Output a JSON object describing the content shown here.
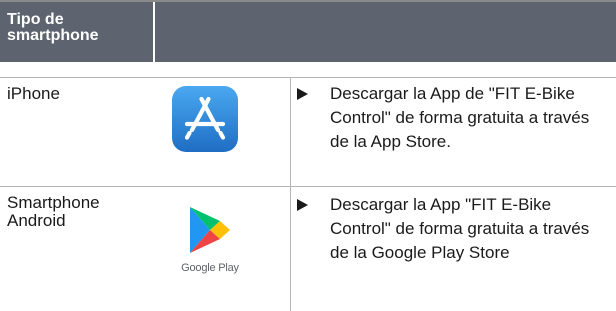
{
  "table": {
    "header": {
      "col1": "Tipo de\nsmartphone",
      "col2": ""
    },
    "rows": [
      {
        "device": "iPhone",
        "store_icon": "app-store-icon",
        "instruction": "Descargar la App de \"FIT E-Bike Control\" de forma gratuita a través de la App Store."
      },
      {
        "device": "Smartphone Android",
        "store_icon": "google-play-icon",
        "store_label": "Google Play",
        "instruction": "Descargar la App \"FIT E-Bike Control\" de forma gratuita a través de la Google Play Store"
      }
    ]
  },
  "colors": {
    "header_bg": "#5d6470",
    "app_store_blue": "#2f7fd4",
    "google_play_green": "#00c26e",
    "google_play_blue": "#2196f3",
    "google_play_red": "#ef4444",
    "google_play_yellow": "#ffc107"
  }
}
